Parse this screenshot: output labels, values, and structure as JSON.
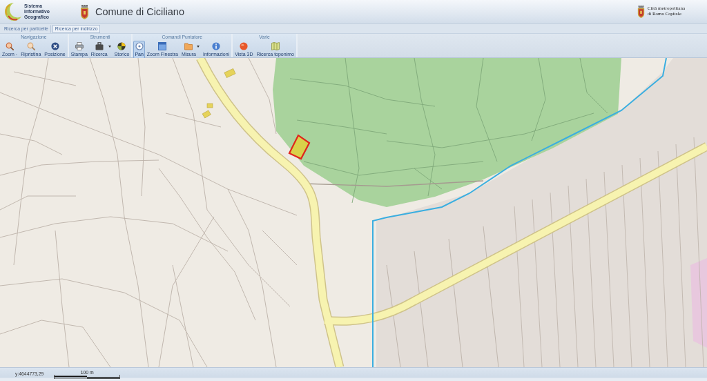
{
  "header": {
    "logo_lines": [
      "Sistema",
      "Informativo",
      "Geografico"
    ],
    "title": "Comune di Ciciliano",
    "partner_lines": [
      "Città metropolitana",
      "di Roma Capitale"
    ]
  },
  "tabs": [
    {
      "label": "Ricerca per particelle",
      "selected": false
    },
    {
      "label": "Ricerca per indirizzo",
      "selected": true
    }
  ],
  "toolbar": {
    "groups": [
      {
        "title": "Navigazione",
        "buttons": [
          {
            "label": "Zoom -",
            "menu": false
          },
          {
            "label": "Ripristina",
            "menu": false
          },
          {
            "label": "Posizione",
            "menu": false
          }
        ]
      },
      {
        "title": "Strumenti",
        "buttons": [
          {
            "label": "Stampa",
            "menu": false
          },
          {
            "label": "Ricerca",
            "menu": true
          },
          {
            "label": "Storico",
            "menu": false
          }
        ]
      },
      {
        "title": "Comandi Puntatore",
        "buttons": [
          {
            "label": "Pan",
            "menu": false,
            "selected": true
          },
          {
            "label": "Zoom Finestra",
            "menu": false,
            "selected": false
          },
          {
            "label": "Misura",
            "menu": true,
            "selected": false
          },
          {
            "label": "Informazioni",
            "menu": false,
            "selected": false
          }
        ]
      },
      {
        "title": "Varie",
        "buttons": [
          {
            "label": "Vista 3D",
            "menu": false
          },
          {
            "label": "Ricerca toponimo",
            "menu": false
          }
        ]
      }
    ]
  },
  "status_bar": {
    "coordinate": "y:4644773,29",
    "scale_label": "100 m"
  }
}
